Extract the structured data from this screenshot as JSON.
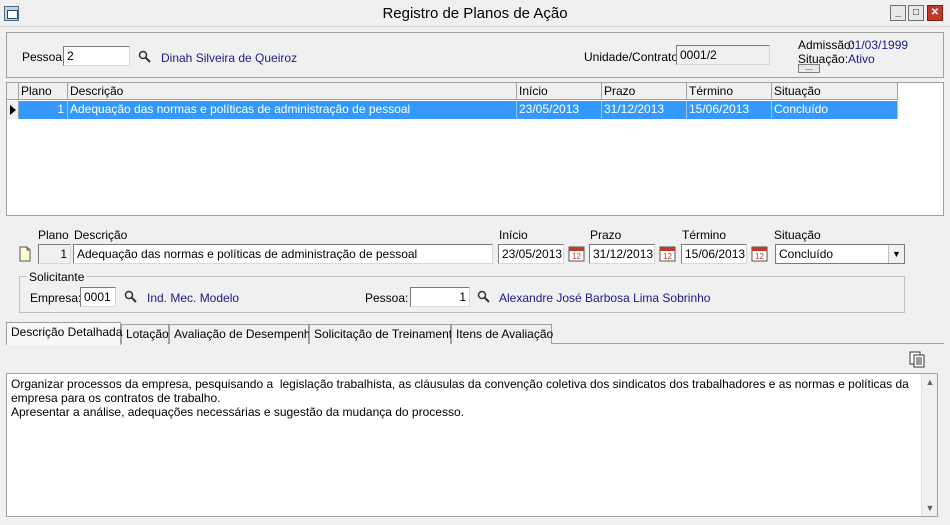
{
  "window": {
    "title": "Registro de Planos de Ação",
    "minimize_label": "_",
    "maximize_label": "□",
    "close_label": "✕"
  },
  "header": {
    "pessoa_label": "Pessoa:",
    "pessoa_value": "2",
    "pessoa_name": "Dinah Silveira de Queiroz",
    "unidade_label": "Unidade/Contrato:",
    "unidade_value": "0001/2",
    "admissao_label": "Admissão:",
    "admissao_value": "01/03/1999",
    "situacao_label": "Situação:",
    "situacao_value": "Ativo",
    "more_button": "..."
  },
  "grid": {
    "columns": [
      "Plano",
      "Descrição",
      "Início",
      "Prazo",
      "Término",
      "Situação"
    ],
    "rows": [
      {
        "plano": "1",
        "descricao": "Adequação das normas e políticas de administração de pessoal",
        "inicio": "23/05/2013",
        "prazo": "31/12/2013",
        "termino": "15/06/2013",
        "situacao": "Concluído"
      }
    ]
  },
  "detail": {
    "plano_label": "Plano",
    "descricao_label": "Descrição",
    "inicio_label": "Início",
    "prazo_label": "Prazo",
    "termino_label": "Término",
    "situacao_label": "Situação",
    "plano_value": "1",
    "descricao_value": "Adequação das normas e políticas de administração de pessoal",
    "inicio_value": "23/05/2013",
    "prazo_value": "31/12/2013",
    "termino_value": "15/06/2013",
    "situacao_value": "Concluído"
  },
  "solicitante": {
    "group_label": "Solicitante",
    "empresa_label": "Empresa:",
    "empresa_value": "0001",
    "empresa_name": "Ind. Mec. Modelo",
    "pessoa_label": "Pessoa:",
    "pessoa_value": "1",
    "pessoa_name": "Alexandre José Barbosa Lima Sobrinho"
  },
  "tabs": [
    {
      "label": "Descrição Detalhada",
      "active": true
    },
    {
      "label": "Lotação"
    },
    {
      "label": "Avaliação de Desempenho"
    },
    {
      "label": "Solicitação de Treinamento"
    },
    {
      "label": "Itens de Avaliação"
    }
  ],
  "memo": {
    "text": "Organizar processos da empresa, pesquisando a  legislação trabalhista, as cláusulas da convenção coletiva dos sindicatos dos trabalhadores e as normas e políticas da empresa para os contratos de trabalho.\nApresentar a análise, adequações necessárias e sugestão da mudança do processo."
  },
  "colors": {
    "selection": "#3399ff",
    "link": "#1a1a8c"
  },
  "icons": [
    "app-icon",
    "search-icon",
    "calendar-icon",
    "new-record-icon",
    "copy-icon",
    "dropdown-arrow-icon"
  ]
}
